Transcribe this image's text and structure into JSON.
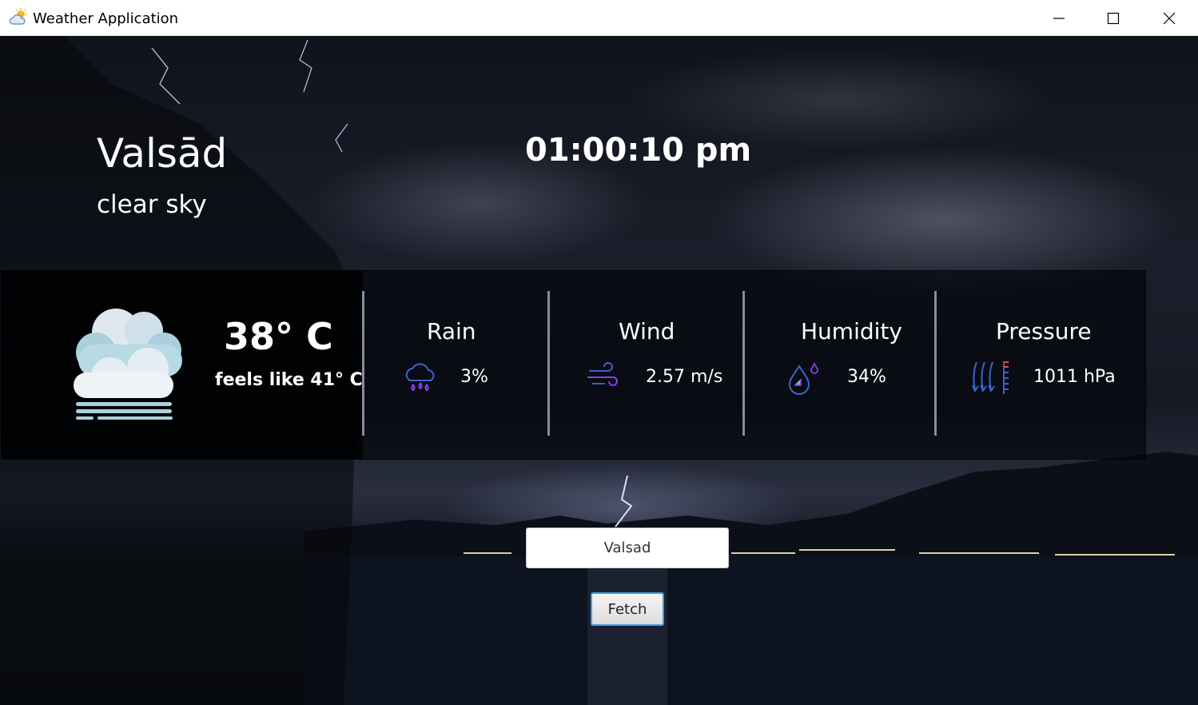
{
  "window": {
    "title": "Weather Application",
    "app_icon": "weather-app-icon",
    "controls": [
      "minimize-icon",
      "maximize-icon",
      "close-icon"
    ]
  },
  "header": {
    "city": "Valsād",
    "description": "clear sky",
    "time": "01:00:10 pm"
  },
  "current": {
    "icon": "cloudy-fog-icon",
    "temperature": "38° C",
    "feels_like": "feels like 41° C"
  },
  "stats": [
    {
      "label": "Rain",
      "value": "3%",
      "icon": "rain-cloud-icon"
    },
    {
      "label": "Wind",
      "value": "2.57 m/s",
      "icon": "wind-icon"
    },
    {
      "label": "Humidity",
      "value": "34%",
      "icon": "humidity-drop-icon"
    },
    {
      "label": "Pressure",
      "value": "1011 hPa",
      "icon": "pressure-gauge-icon"
    }
  ],
  "search": {
    "value": "Valsad",
    "button_label": "Fetch"
  },
  "colors": {
    "icon_accent": "#8a3cf0",
    "icon_blue": "#3d63c9",
    "pressure_red": "#e0503c",
    "button_border": "#3aa0d8"
  }
}
